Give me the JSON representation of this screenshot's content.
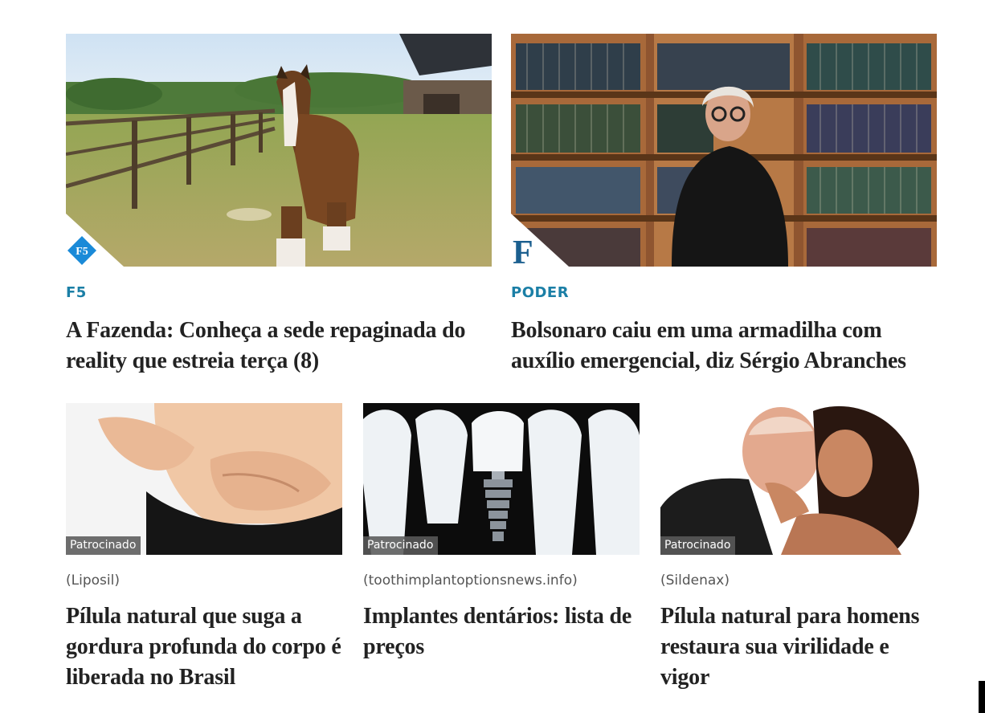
{
  "top_cards": [
    {
      "category": "F5",
      "headline": "A Fazenda: Conheça a sede repaginada do reality que estreia terça (8)",
      "logo_text": "F5",
      "image_subject": "horse-on-farm"
    },
    {
      "category": "PODER",
      "headline": "Bolsonaro caiu em uma armadilha com auxílio emergencial, diz Sérgio Abranches",
      "logo_text": "F",
      "image_subject": "man-in-library"
    }
  ],
  "sponsored_cards": [
    {
      "badge": "Patrocinado",
      "source": "(Liposil)",
      "headline": "Pílula natural que suga a gordura profunda do corpo é liberada no Brasil",
      "image_subject": "belly-fat"
    },
    {
      "badge": "Patrocinado",
      "source": "(toothimplantoptionsnews.info)",
      "headline": "Implantes dentários: lista de preços",
      "image_subject": "dental-implant"
    },
    {
      "badge": "Patrocinado",
      "source": "(Sildenax)",
      "headline": "Pílula natural para homens restaura sua virilidade e vigor",
      "image_subject": "couple"
    }
  ],
  "colors": {
    "category_blue": "#1b7fa6",
    "headline": "#222222",
    "source_gray": "#555555",
    "badge_bg": "#5a5a5a"
  }
}
